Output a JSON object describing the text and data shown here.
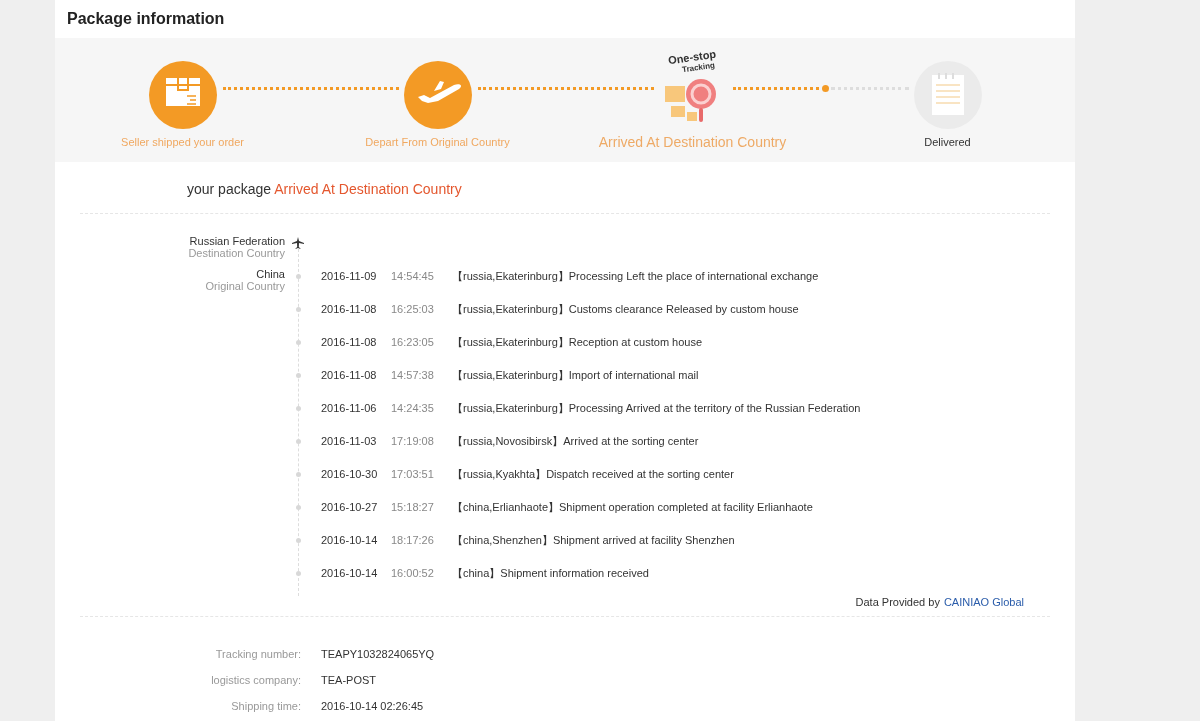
{
  "header": {
    "title": "Package information"
  },
  "steps": [
    {
      "label": "Seller shipped your order",
      "done": true,
      "current": false,
      "kind": "box"
    },
    {
      "label": "Depart From Original Country",
      "done": true,
      "current": false,
      "kind": "plane"
    },
    {
      "label": "Arrived At Destination Country",
      "done": false,
      "current": true,
      "kind": "tracking",
      "badge": [
        "One-stop",
        "Tracking"
      ]
    },
    {
      "label": "Delivered",
      "done": false,
      "current": false,
      "kind": "notepad"
    }
  ],
  "status": {
    "prefix": "your package",
    "value": "Arrived At Destination Country"
  },
  "route": [
    {
      "country": "Russian Federation",
      "role": "Destination Country",
      "kind": "plane"
    },
    {
      "country": "China",
      "role": "Original Country",
      "kind": "dot"
    }
  ],
  "events": [
    {
      "date": "2016-11-09",
      "time": "14:54:45",
      "text": "【russia,Ekaterinburg】Processing Left the place of international exchange"
    },
    {
      "date": "2016-11-08",
      "time": "16:25:03",
      "text": "【russia,Ekaterinburg】Customs clearance Released by custom house"
    },
    {
      "date": "2016-11-08",
      "time": "16:23:05",
      "text": "【russia,Ekaterinburg】Reception at custom house"
    },
    {
      "date": "2016-11-08",
      "time": "14:57:38",
      "text": "【russia,Ekaterinburg】Import of international mail"
    },
    {
      "date": "2016-11-06",
      "time": "14:24:35",
      "text": "【russia,Ekaterinburg】Processing Arrived at the territory of the Russian Federation"
    },
    {
      "date": "2016-11-03",
      "time": "17:19:08",
      "text": "【russia,Novosibirsk】Arrived at the sorting center"
    },
    {
      "date": "2016-10-30",
      "time": "17:03:51",
      "text": "【russia,Kyakhta】Dispatch received at the sorting center"
    },
    {
      "date": "2016-10-27",
      "time": "15:18:27",
      "text": "【china,Erlianhaote】Shipment operation completed at facility Erlianhaote"
    },
    {
      "date": "2016-10-14",
      "time": "18:17:26",
      "text": "【china,Shenzhen】Shipment arrived at facility Shenzhen"
    },
    {
      "date": "2016-10-14",
      "time": "16:00:52",
      "text": "【china】Shipment information received"
    }
  ],
  "provider": {
    "prefix": "Data Provided by",
    "link": "CAINIAO Global"
  },
  "details": [
    {
      "label": "Tracking number:",
      "value": "TEAPY1032824065YQ"
    },
    {
      "label": "logistics company:",
      "value": "TEA-POST"
    },
    {
      "label": "Shipping time:",
      "value": "2016-10-14 02:26:45"
    }
  ]
}
